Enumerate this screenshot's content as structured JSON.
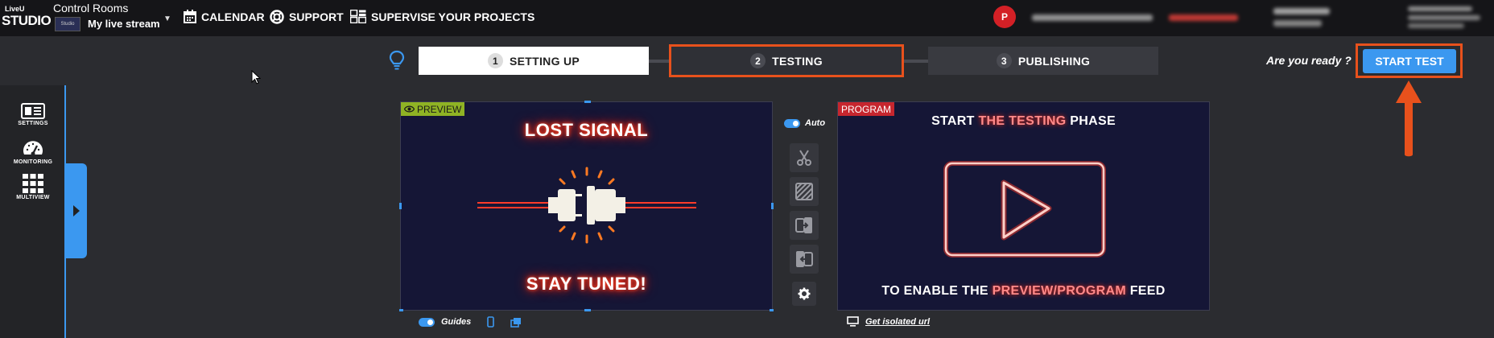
{
  "topbar": {
    "logo_line1": "LiveU",
    "logo_line2": "STUDIO",
    "control_rooms": "Control Rooms",
    "stream_thumb": "Studio",
    "stream_name": "My live stream",
    "nav": {
      "calendar": "CALENDAR",
      "support": "SUPPORT",
      "supervise": "SUPERVISE YOUR PROJECTS"
    },
    "avatar_initial": "P"
  },
  "stepper": {
    "steps": [
      {
        "num": "1",
        "label": "SETTING UP"
      },
      {
        "num": "2",
        "label": "TESTING"
      },
      {
        "num": "3",
        "label": "PUBLISHING"
      }
    ],
    "ready_text": "Are you ready ?",
    "start_button": "START TEST"
  },
  "sidebar": {
    "items": [
      {
        "label": "SETTINGS"
      },
      {
        "label": "MONITORING"
      },
      {
        "label": "MULTIVIEW"
      }
    ]
  },
  "preview": {
    "tag": "PREVIEW",
    "line_top": "LOST SIGNAL",
    "line_bottom": "STAY TUNED!"
  },
  "program": {
    "tag": "PROGRAM",
    "top_pre": "START ",
    "top_hl": "THE TESTING",
    "top_post": " PHASE",
    "bottom_pre": "TO ENABLE THE ",
    "bottom_hl": "PREVIEW/PROGRAM",
    "bottom_post": " FEED"
  },
  "controls": {
    "auto_label": "Auto"
  },
  "bottom": {
    "guides_label": "Guides",
    "isolated_url": "Get isolated url"
  },
  "colors": {
    "accent_blue": "#3b98f0",
    "highlight_orange": "#e8511c",
    "preview_green": "#8fb324",
    "program_red": "#c6262e"
  }
}
